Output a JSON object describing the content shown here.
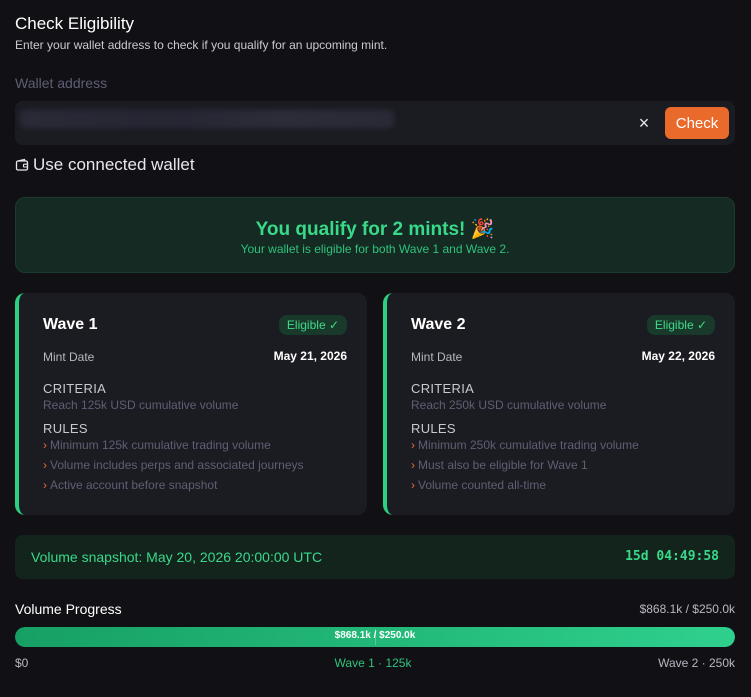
{
  "header": {
    "title": "Check Eligibility",
    "subtitle": "Enter your wallet address to check if you qualify for an upcoming mint."
  },
  "wallet": {
    "label": "Wallet address",
    "value": "",
    "clear_symbol": "×",
    "check_label": "Check",
    "use_connected_label": "Use connected wallet"
  },
  "result": {
    "title": "You qualify for 2 mints! 🎉",
    "subtitle": "Your wallet is eligible for both Wave 1 and Wave 2."
  },
  "waves": [
    {
      "title": "Wave 1",
      "badge": "Eligible ✓",
      "mint_date_label": "Mint Date",
      "mint_date": "May 21, 2026",
      "criteria_label": "CRITERIA",
      "criteria": "Reach 125k USD cumulative volume",
      "rules_label": "RULES",
      "rules": [
        "Minimum 125k cumulative trading volume",
        "Volume includes perps and associated journeys",
        "Active account before snapshot"
      ]
    },
    {
      "title": "Wave 2",
      "badge": "Eligible ✓",
      "mint_date_label": "Mint Date",
      "mint_date": "May 22, 2026",
      "criteria_label": "CRITERIA",
      "criteria": "Reach 250k USD cumulative volume",
      "rules_label": "RULES",
      "rules": [
        "Minimum 250k cumulative trading volume",
        "Must also be eligible for Wave 1",
        "Volume counted all-time"
      ]
    }
  ],
  "snapshot": {
    "text": "Volume snapshot: May 20, 2026 20:00:00 UTC",
    "countdown": "15d 04:49:58"
  },
  "progress": {
    "title": "Volume Progress",
    "summary": "$868.1k / $250.0k",
    "bar_label": "$868.1k / $250.0k",
    "fill_fraction": 1.0,
    "wave1_fraction": 0.5,
    "tick_start": "$0",
    "tick_wave1": "Wave 1 · 125k",
    "tick_wave2": "Wave 2 · 250k"
  },
  "colors": {
    "accent_orange": "#ea6a2c",
    "success_green": "#39d98a",
    "background": "#111115",
    "card": "#1b1b22"
  }
}
